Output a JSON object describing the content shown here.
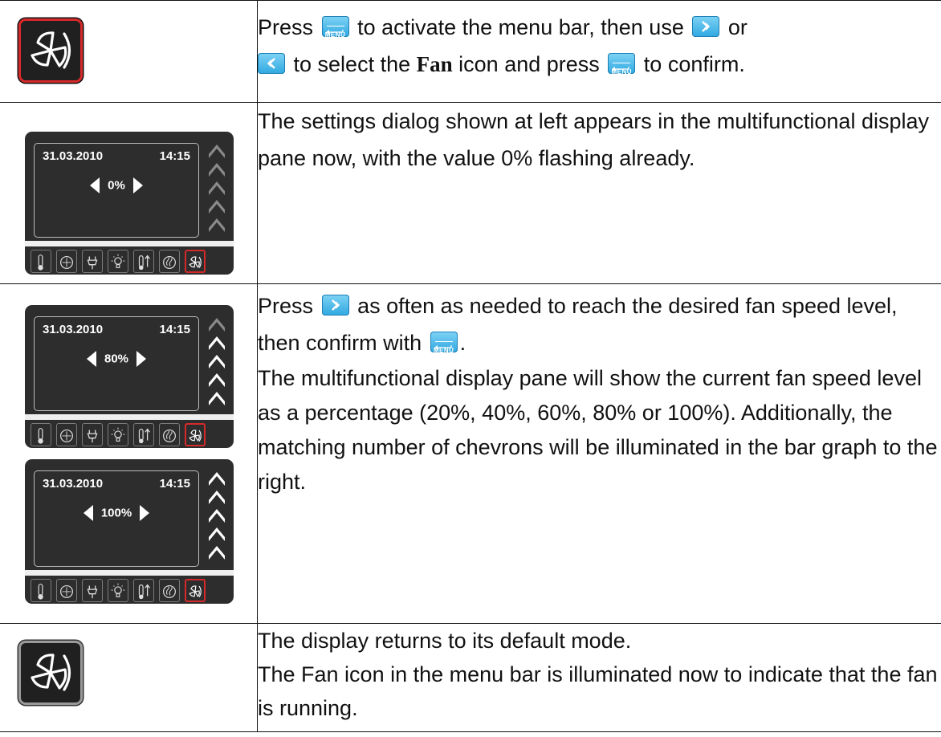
{
  "rows": [
    {
      "icon": "fan-icon-red-selected",
      "text": {
        "t1": "Press",
        "t2": "to activate the menu bar, then use",
        "t3": "or",
        "t4": "to select the",
        "t5": "Fan",
        "t6": "icon and press",
        "t7": "to confirm."
      }
    },
    {
      "panel": {
        "date": "31.03.2010",
        "time": "14:15",
        "value": "0%",
        "chevrons_lit": 0
      },
      "text": "The settings dialog shown at left appears in the multifunctional display pane now, with the value 0% flashing already."
    },
    {
      "panels": [
        {
          "date": "31.03.2010",
          "time": "14:15",
          "value": "80%",
          "chevrons_lit": 4
        },
        {
          "date": "31.03.2010",
          "time": "14:15",
          "value": "100%",
          "chevrons_lit": 5
        }
      ],
      "text": {
        "t1": "Press",
        "t2": "as often as needed to reach the desired fan speed level, then confirm with",
        "t3": ".",
        "p2": "The multifunctional display pane will show the current fan speed level as a percentage (20%, 40%, 60%, 80% or 100%). Additionally, the matching number of chevrons will be illuminated in the bar graph to the right."
      }
    },
    {
      "icon": "fan-icon-gray-illuminated",
      "text": {
        "l1": "The display returns to its default mode.",
        "l2": "The Fan icon in the menu bar is illuminated now to indicate that the fan is running."
      }
    }
  ],
  "keycaps": {
    "menu_label": "MENU"
  },
  "colors": {
    "keycap": "#2fa8e0",
    "selected": "#d62a2a",
    "panel": "#2d2d2d",
    "chevron_lit": "#ffffff",
    "chevron_dim": "#8a8a8a"
  }
}
